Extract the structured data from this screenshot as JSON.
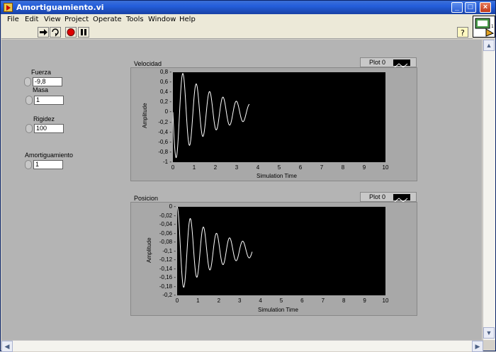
{
  "window": {
    "title": "Amortiguamiento.vi"
  },
  "menu": [
    "File",
    "Edit",
    "View",
    "Project",
    "Operate",
    "Tools",
    "Window",
    "Help"
  ],
  "controls": [
    {
      "label": "Fuerza",
      "value": "-9,8"
    },
    {
      "label": "Masa",
      "value": "1"
    },
    {
      "label": "Rigidez",
      "value": "100"
    },
    {
      "label": "Amortiguamiento",
      "value": "1"
    }
  ],
  "graphs": [
    {
      "label": "Velocidad",
      "legend": "Plot 0",
      "yticks": [
        "0,8",
        "0,6",
        "0,4",
        "0,2",
        "0",
        "-0,2",
        "-0,4",
        "-0,6",
        "-0,8",
        "-1"
      ],
      "xticks": [
        "0",
        "1",
        "2",
        "3",
        "4",
        "5",
        "6",
        "7",
        "8",
        "9",
        "10"
      ],
      "ylabel": "Amplitude",
      "xlabel": "Simulation Time"
    },
    {
      "label": "Posicion",
      "legend": "Plot 0",
      "yticks": [
        "0",
        "-0,02",
        "-0,04",
        "-0,06",
        "-0,08",
        "-0,1",
        "-0,12",
        "-0,14",
        "-0,16",
        "-0,18",
        "-0,2"
      ],
      "xticks": [
        "0",
        "1",
        "2",
        "3",
        "4",
        "5",
        "6",
        "7",
        "8",
        "9",
        "10"
      ],
      "ylabel": "Amplitude",
      "xlabel": "Simulation Time"
    }
  ],
  "signal": {
    "force": -9.8,
    "mass": 1,
    "stiffness": 100,
    "damping": 1,
    "t_end": 3.6
  },
  "colors": {
    "plot_bg": "#000000",
    "trace": "#ffffff"
  }
}
